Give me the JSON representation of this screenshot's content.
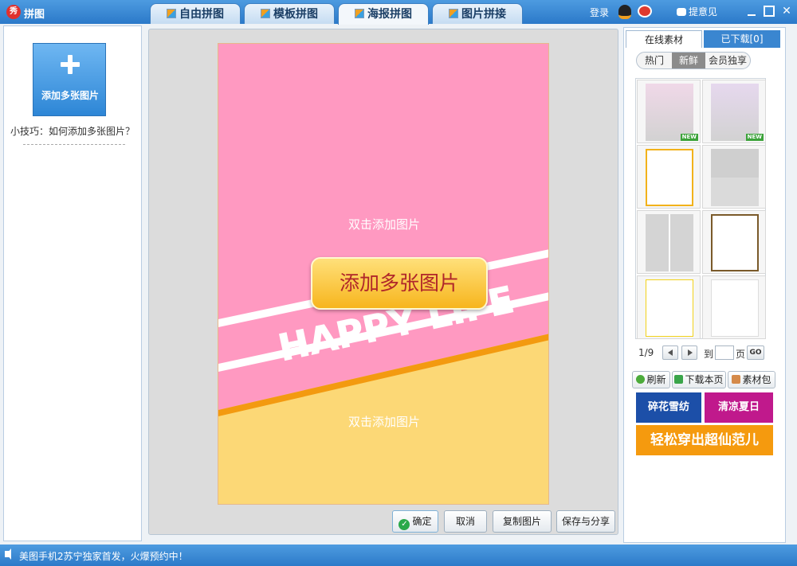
{
  "app": {
    "title": "拼图",
    "logo_char": "秀"
  },
  "tabs": [
    {
      "label": "自由拼图"
    },
    {
      "label": "模板拼图"
    },
    {
      "label": "海报拼图"
    },
    {
      "label": "图片拼接"
    }
  ],
  "topbar": {
    "login": "登录",
    "feedback": "提意见"
  },
  "left": {
    "add_label": "添加多张图片",
    "tip": "小技巧：如何添加多张图片？"
  },
  "poster": {
    "slot_top": "双击添加图片",
    "slot_bottom": "双击添加图片",
    "add_overlay": "添加多张图片",
    "banner_text": "HAPPY LIFE",
    "colors": {
      "pink": "#ff99c1",
      "yellow": "#fcd876",
      "orange": "#f39a10"
    }
  },
  "actions": {
    "ok": "确定",
    "cancel": "取消",
    "copy": "复制图片",
    "save": "保存与分享"
  },
  "right": {
    "tab_online": "在线素材",
    "tab_downloaded": "已下载[0]",
    "filters": [
      "热门",
      "新鲜",
      "会员独享"
    ],
    "new_badge": "NEW",
    "pager": {
      "page": "1/9",
      "to": "到",
      "page_unit": "页",
      "go": "GO"
    },
    "tools": {
      "refresh": "刷新",
      "download_page": "下载本页",
      "pack": "素材包"
    },
    "promos": {
      "p1": "碎花雪纺",
      "p2": "清凉夏日",
      "p3": "轻松穿出超仙范儿"
    }
  },
  "status": {
    "text": "美图手机2苏宁独家首发，火爆预约中！"
  }
}
